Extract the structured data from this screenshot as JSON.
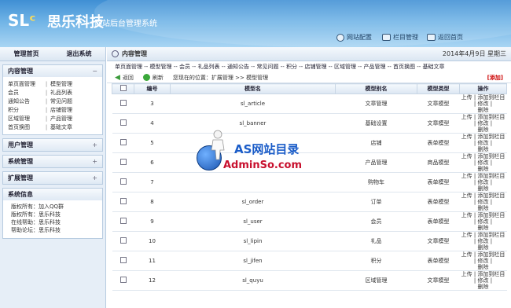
{
  "header": {
    "logo_text": "SL",
    "brand_name": "思乐科技",
    "system_title": "网站后台管理系统",
    "links": [
      {
        "label": "网站配置",
        "icon": "gear-icon"
      },
      {
        "label": "栏目管理",
        "icon": "column-icon"
      },
      {
        "label": "返回首页",
        "icon": "home-icon"
      }
    ]
  },
  "sidebar": {
    "top_links": [
      "管理首页",
      "退出系统"
    ],
    "content_panel": {
      "title": "内容管理",
      "sign": "−",
      "rows": [
        [
          "单页面管理",
          "模型管理"
        ],
        [
          "会员",
          "礼品列表"
        ],
        [
          "通知公告",
          "常见问题"
        ],
        [
          "积分",
          "店铺管理"
        ],
        [
          "区域管理",
          "产品管理"
        ],
        [
          "首页换图",
          "基础文章"
        ]
      ],
      "separator": "|"
    },
    "collapsed_panels": [
      {
        "title": "用户管理",
        "sign": "+"
      },
      {
        "title": "系统管理",
        "sign": "+"
      },
      {
        "title": "扩展管理",
        "sign": "+"
      }
    ],
    "sysinfo": {
      "title": "系统信息",
      "lines": [
        "版权所有：加入QQ群",
        "版权所有：思乐科技",
        "在线帮助：思乐科技",
        "帮助论坛：思乐科技"
      ]
    }
  },
  "main": {
    "title": "内容管理",
    "date": "2014年4月9日 星期三",
    "subnav": "单页面管理 -- 模型管理 -- 会员 -- 礼品列表 -- 通知公告 -- 常见问题 -- 积分 -- 店铺管理 -- 区域管理 -- 产品管理 -- 首页换图 -- 基础文章",
    "toolbar": {
      "back_label": "返回",
      "refresh_label": "刷新",
      "location": "您现在的位置：扩展管理 >> 模型管理",
      "add_label": "[添加]"
    },
    "table": {
      "headers": [
        "",
        "编号",
        "模型名",
        "模型别名",
        "模型类型",
        "操作"
      ],
      "rows": [
        {
          "id": "3",
          "name": "sl_article",
          "alias": "文章管理",
          "type": "文章模型"
        },
        {
          "id": "4",
          "name": "sl_banner",
          "alias": "基础设置",
          "type": "文章模型"
        },
        {
          "id": "5",
          "name": "",
          "alias": "店铺",
          "type": "表单模型"
        },
        {
          "id": "6",
          "name": "",
          "alias": "产品管理",
          "type": "商品模型"
        },
        {
          "id": "7",
          "name": "",
          "alias": "购物车",
          "type": "表单模型"
        },
        {
          "id": "8",
          "name": "sl_order",
          "alias": "订单",
          "type": "表单模型"
        },
        {
          "id": "9",
          "name": "sl_user",
          "alias": "会员",
          "type": "表单模型"
        },
        {
          "id": "10",
          "name": "sl_lipin",
          "alias": "礼品",
          "type": "文章模型"
        },
        {
          "id": "11",
          "name": "sl_jifen",
          "alias": "积分",
          "type": "表单模型"
        },
        {
          "id": "12",
          "name": "sl_quyu",
          "alias": "区域管理",
          "type": "文章模型"
        }
      ],
      "ops_line1": "上传 | 添加到栏目 | 修改 |",
      "ops_line2": "删除"
    }
  },
  "watermark": {
    "line1": "AS网站目录",
    "line2": "AdminSo.com"
  }
}
